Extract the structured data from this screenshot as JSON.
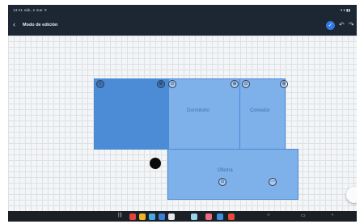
{
  "status_bar": {
    "left_text": "13:41 sáb, 2 mar ✕",
    "right_text": "▾ ▾ ▮▮"
  },
  "header": {
    "back_glyph": "‹",
    "title": "Modo de edición",
    "confirm_glyph": "✓",
    "undo_glyph": "↶",
    "redo_glyph": "↷"
  },
  "rooms": [
    {
      "id": "room-1",
      "label": ""
    },
    {
      "id": "room-2",
      "label": "Dormitorio"
    },
    {
      "id": "room-3",
      "label": "Comedor"
    },
    {
      "id": "room-4",
      "label": "Oficina"
    }
  ],
  "control_glyphs": {
    "info": "i",
    "split": "⊕",
    "pin": "⊙",
    "more": "⋯"
  },
  "colors": {
    "room_fill_dark": "#4c8bd6",
    "room_fill_light": "#7eb0ea",
    "appbar_bg": "#1c2733",
    "accent": "#2f7ae5"
  },
  "navbar": {
    "back_glyph": "‹",
    "home_glyph": "○",
    "recents_glyph": "|||",
    "split_glyph": "▭",
    "app_colors": [
      "#e0463a",
      "#f0b323",
      "#48a9e0",
      "#3a7cd6",
      "#e4e8ee",
      "#9bd2f0",
      "#ef6b7f",
      "#3d8fe0",
      "#e74b3c"
    ]
  }
}
